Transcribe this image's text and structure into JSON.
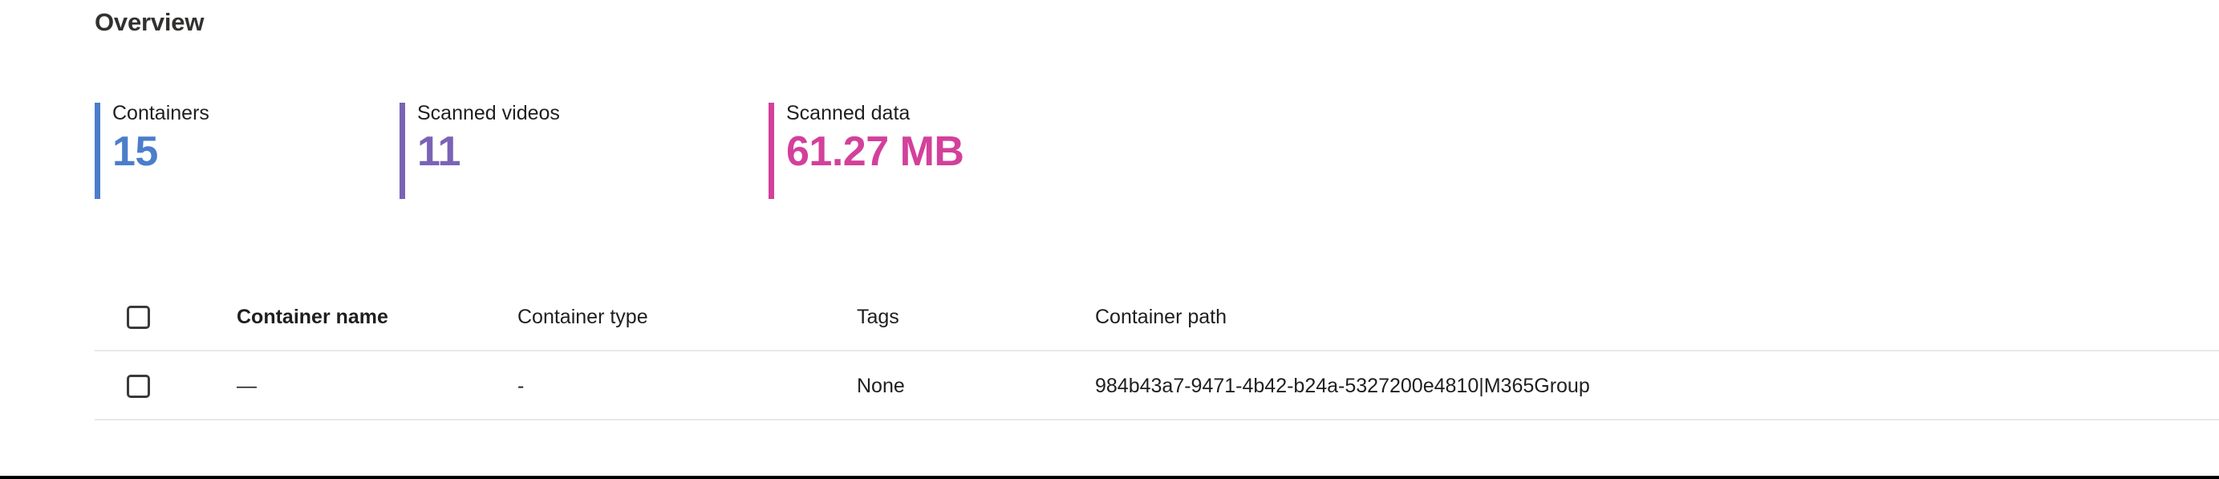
{
  "section": {
    "title": "Overview"
  },
  "colors": {
    "containers_accent": "#4a7ecb",
    "videos_accent": "#7a63b5",
    "data_accent": "#d3409b",
    "text": "#201f1e",
    "heading": "#323130",
    "divider": "#e8e8e8",
    "checkbox_border": "#3b3a39"
  },
  "stats": [
    {
      "label": "Containers",
      "value": "15",
      "accent": "#4a7ecb",
      "icon": "accent-bar"
    },
    {
      "label": "Scanned videos",
      "value": "11",
      "accent": "#7a63b5",
      "icon": "accent-bar"
    },
    {
      "label": "Scanned data",
      "value": "61.27 MB",
      "accent": "#d3409b",
      "icon": "accent-bar"
    }
  ],
  "table": {
    "select_all": {
      "icon": "checkbox-icon",
      "checked": false
    },
    "columns": [
      {
        "key": "name",
        "label": "Container name",
        "bold": true
      },
      {
        "key": "type",
        "label": "Container type",
        "bold": false
      },
      {
        "key": "tags",
        "label": "Tags",
        "bold": false
      },
      {
        "key": "path",
        "label": "Container path",
        "bold": false
      }
    ],
    "rows": [
      {
        "checkbox": {
          "icon": "checkbox-icon",
          "checked": false
        },
        "name": "—",
        "type": "-",
        "tags": "None",
        "path": "984b43a7-9471-4b42-b24a-5327200e4810|M365Group"
      }
    ]
  }
}
